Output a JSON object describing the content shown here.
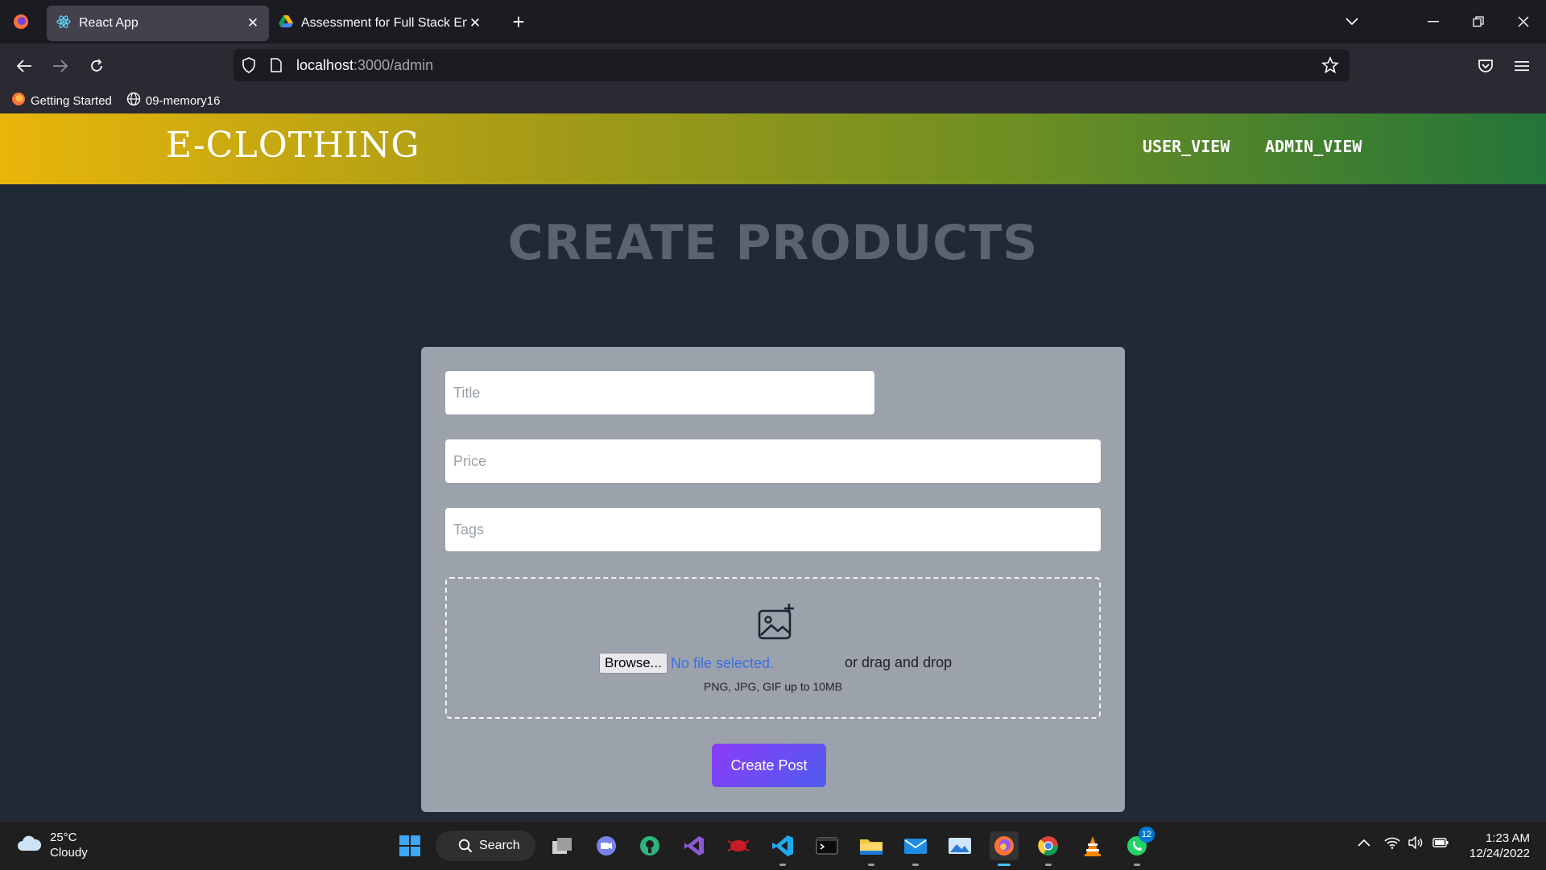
{
  "browser": {
    "tabs": [
      {
        "title": "React App",
        "active": true
      },
      {
        "title": "Assessment for Full Stack Engin",
        "active": false
      }
    ],
    "url": {
      "host": "localhost",
      "path": ":3000/admin"
    },
    "bookmarks": [
      "Getting Started",
      "09-memory16"
    ]
  },
  "header": {
    "brand": "E-CLOTHING",
    "nav": [
      "USER_VIEW",
      "ADMIN_VIEW"
    ]
  },
  "page": {
    "title": "CREATE PRODUCTS"
  },
  "form": {
    "title_placeholder": "Title",
    "price_placeholder": "Price",
    "tags_placeholder": "Tags",
    "browse_label": "Browse...",
    "file_status": "No file selected.",
    "drag_text": "or drag and drop",
    "hint": "PNG, JPG, GIF up to 10MB",
    "submit_label": "Create Post"
  },
  "taskbar": {
    "weather": {
      "temp": "25°C",
      "condition": "Cloudy"
    },
    "search_label": "Search",
    "whatsapp_badge": "12",
    "time": "1:23 AM",
    "date": "12/24/2022"
  },
  "colors": {
    "page_bg": "#212836",
    "card_bg": "#9ca2ac",
    "header_gradient_start": "#e9b50a",
    "header_gradient_end": "#237539",
    "submit_gradient_start": "#8b3cf7",
    "submit_gradient_end": "#4f5cf0",
    "title_color": "#5b6270"
  }
}
